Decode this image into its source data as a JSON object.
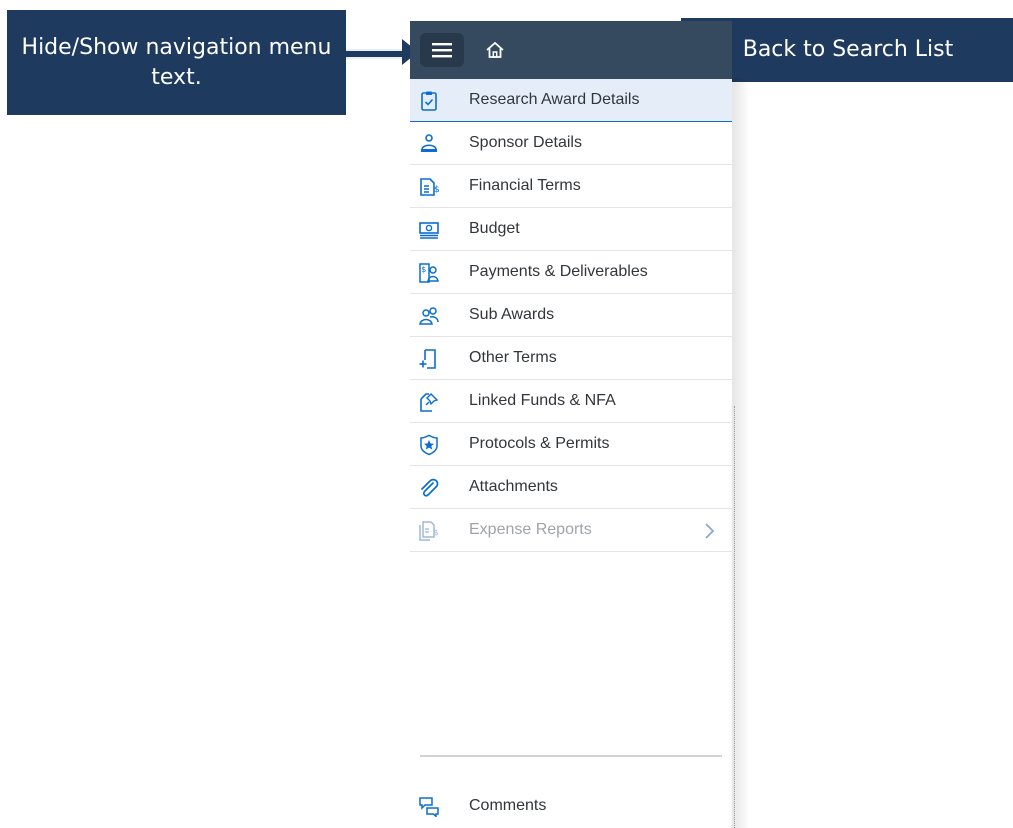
{
  "callouts": {
    "left": "Hide/Show navigation menu text.",
    "right": "Back to Search List"
  },
  "header": {
    "menu_icon": "hamburger-menu-icon",
    "home_icon": "home-icon"
  },
  "nav": {
    "items": [
      {
        "label": "Research Award Details",
        "icon": "clipboard-check-icon",
        "selected": true,
        "disabled": false
      },
      {
        "label": "Sponsor Details",
        "icon": "sponsor-person-icon",
        "selected": false,
        "disabled": false
      },
      {
        "label": "Financial Terms",
        "icon": "document-dollar-icon",
        "selected": false,
        "disabled": false
      },
      {
        "label": "Budget",
        "icon": "money-bills-icon",
        "selected": false,
        "disabled": false
      },
      {
        "label": "Payments & Deliverables",
        "icon": "payment-person-icon",
        "selected": false,
        "disabled": false
      },
      {
        "label": "Sub Awards",
        "icon": "group-icon",
        "selected": false,
        "disabled": false
      },
      {
        "label": "Other Terms",
        "icon": "add-document-icon",
        "selected": false,
        "disabled": false
      },
      {
        "label": "Linked Funds & NFA",
        "icon": "pushpin-document-icon",
        "selected": false,
        "disabled": false
      },
      {
        "label": "Protocols & Permits",
        "icon": "badge-star-icon",
        "selected": false,
        "disabled": false
      },
      {
        "label": "Attachments",
        "icon": "paperclip-icon",
        "selected": false,
        "disabled": false
      },
      {
        "label": "Expense Reports",
        "icon": "expense-document-icon",
        "selected": false,
        "disabled": true
      }
    ],
    "footer": {
      "label": "Comments",
      "icon": "comments-icon"
    }
  },
  "colors": {
    "callout_bg": "#1f3a5f",
    "header_bg": "#354a5f",
    "selected_bg": "#e5eef8",
    "icon_blue": "#0a6ed1"
  }
}
